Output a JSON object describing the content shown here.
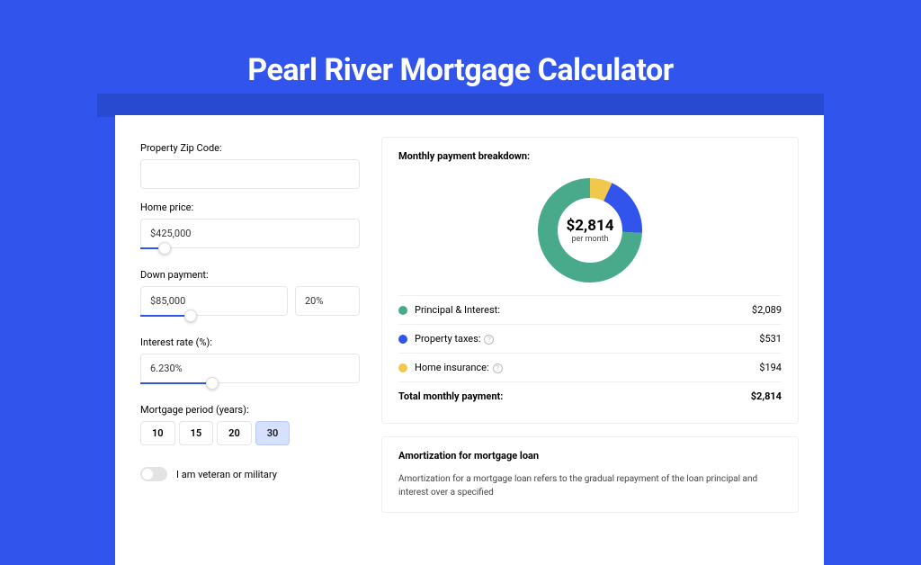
{
  "title": "Pearl River Mortgage Calculator",
  "form": {
    "zip_label": "Property Zip Code:",
    "zip_value": "",
    "price_label": "Home price:",
    "price_value": "$425,000",
    "price_slider_pct": 8,
    "down_label": "Down payment:",
    "down_value": "$85,000",
    "down_pct": "20%",
    "down_slider_pct": 20,
    "rate_label": "Interest rate (%):",
    "rate_value": "6.230%",
    "rate_slider_pct": 30,
    "period_label": "Mortgage period (years):",
    "periods": [
      "10",
      "15",
      "20",
      "30"
    ],
    "period_selected": "30",
    "veteran_label": "I am veteran or military"
  },
  "breakdown": {
    "title": "Monthly payment breakdown:",
    "center_value": "$2,814",
    "center_sub": "per month",
    "items": [
      {
        "color": "#48a98b",
        "label": "Principal & Interest:",
        "value": "$2,089",
        "info": false
      },
      {
        "color": "#3155ec",
        "label": "Property taxes:",
        "value": "$531",
        "info": true
      },
      {
        "color": "#f1c84c",
        "label": "Home insurance:",
        "value": "$194",
        "info": true
      }
    ],
    "total_label": "Total monthly payment:",
    "total_value": "$2,814"
  },
  "amort": {
    "title": "Amortization for mortgage loan",
    "body": "Amortization for a mortgage loan refers to the gradual repayment of the loan principal and interest over a specified"
  },
  "chart_data": {
    "type": "pie",
    "title": "Monthly payment breakdown",
    "series": [
      {
        "name": "Principal & Interest",
        "value": 2089,
        "color": "#48a98b"
      },
      {
        "name": "Property taxes",
        "value": 531,
        "color": "#3155ec"
      },
      {
        "name": "Home insurance",
        "value": 194,
        "color": "#f1c84c"
      }
    ],
    "total": 2814,
    "angles_deg": [
      267.3,
      67.9,
      24.8
    ]
  }
}
